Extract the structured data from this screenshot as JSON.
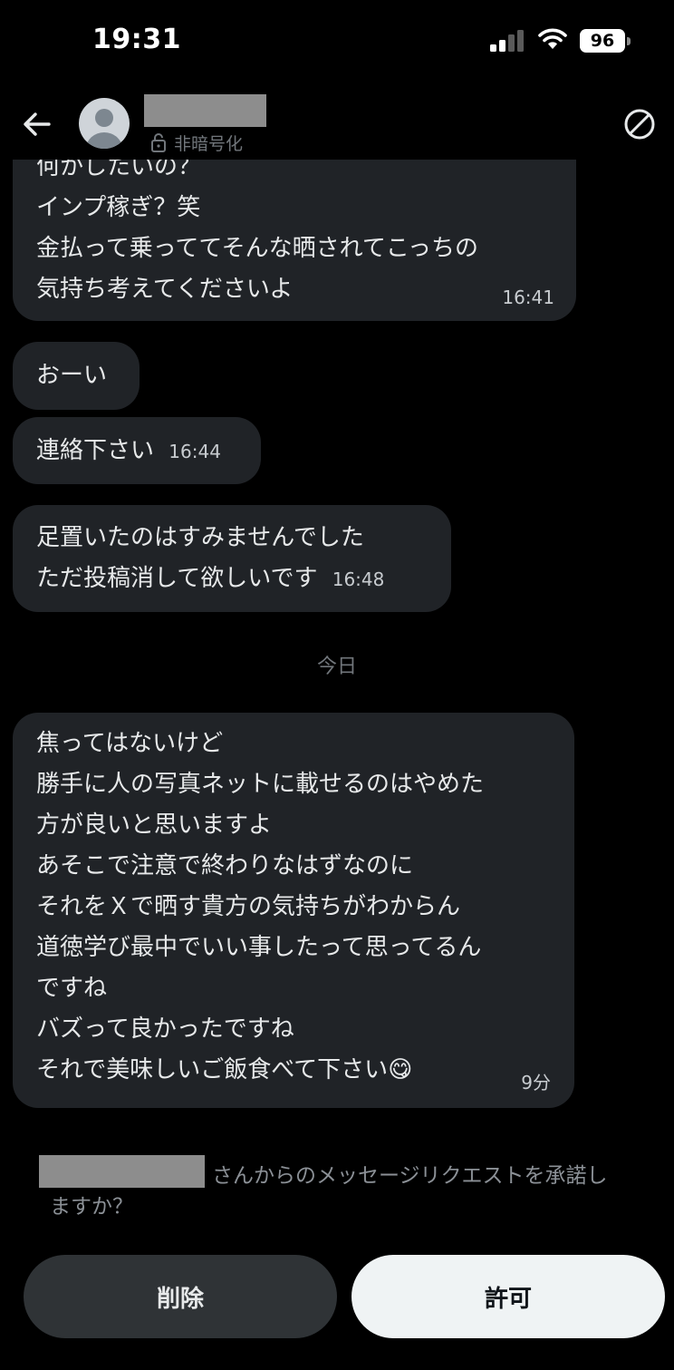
{
  "status_bar": {
    "time": "19:31",
    "battery": "96"
  },
  "header": {
    "encryption_label": "非暗号化"
  },
  "messages": [
    {
      "lines": [
        "何かしたいの？",
        "インプ稼ぎ？笑",
        "金払って乗っててそんな晒されてこっちの",
        "気持ち考えてくださいよ"
      ],
      "time": "16:41"
    },
    {
      "lines": [
        "おーい"
      ],
      "time": ""
    },
    {
      "lines": [
        "連絡下さい"
      ],
      "time": "16:44"
    },
    {
      "lines": [
        "足置いたのはすみませんでした",
        "ただ投稿消して欲しいです"
      ],
      "time": "16:48"
    },
    {
      "lines": [
        "焦ってはないけど",
        "勝手に人の写真ネットに載せるのはやめた",
        "方が良いと思いますよ",
        "あそこで注意で終わりなはずなのに",
        "それをＸで晒す貴方の気持ちがわからん",
        "道徳学び最中でいい事したって思ってるん",
        "ですね",
        "バズって良かったですね",
        "それで美味しいご飯食べて下さい"
      ],
      "emoji": "😋",
      "time": "9分"
    }
  ],
  "date_separator": "今日",
  "request": {
    "line1": "さんからのメッセージリクエストを承諾し",
    "line2": "ますか？"
  },
  "actions": {
    "delete_label": "削除",
    "allow_label": "許可"
  },
  "colors": {
    "background": "#000000",
    "bubble": "#202327",
    "muted_text": "#71767b",
    "allow_button": "#eff3f4",
    "delete_button": "#2f3336"
  },
  "icons": [
    "signal-icon",
    "wifi-icon",
    "battery-icon",
    "back-arrow-icon",
    "avatar-icon",
    "lock-icon",
    "block-icon"
  ]
}
